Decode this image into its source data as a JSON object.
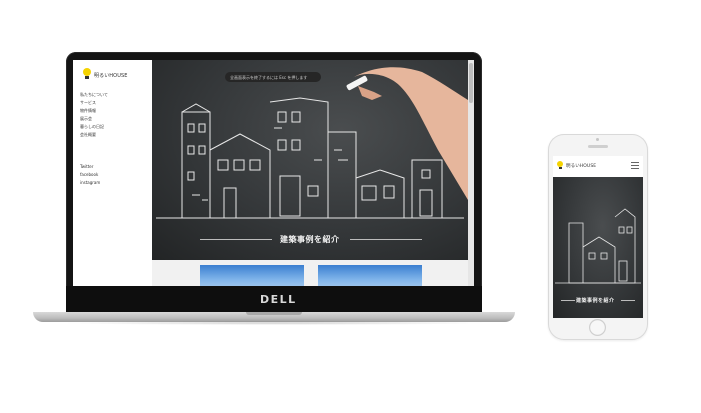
{
  "laptop": {
    "brand": "DELL",
    "logo_text": "明るいHOUSE",
    "nav": [
      "私たちについて",
      "サービス",
      "物件情報",
      "展示会",
      "暮らしの日記",
      "会社概要"
    ],
    "social": [
      "Twitter",
      "facebook",
      "instagram"
    ],
    "overlay_text": "全画面表示を終了するには Esc を押します",
    "section_title": "建築事例を紹介"
  },
  "phone": {
    "logo_text": "明るいHOUSE",
    "section_title": "建築事例を紹介"
  },
  "colors": {
    "accent_bulb": "#f5d300",
    "chalkboard": "#343739",
    "chalk": "#e8e8e8"
  },
  "icons": [
    "lightbulb-logo-icon",
    "hamburger-menu-icon",
    "home-button-icon"
  ]
}
